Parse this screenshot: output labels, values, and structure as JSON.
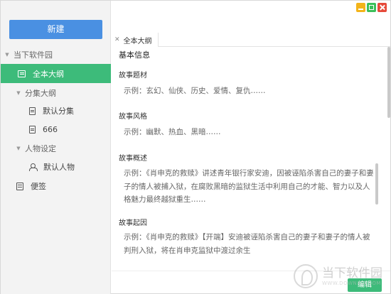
{
  "window": {
    "controls": [
      "minimize",
      "maximize",
      "close"
    ]
  },
  "sidebar": {
    "new_button": "新建",
    "groups": [
      {
        "label": "当下软件园"
      },
      {
        "label": "全本大纲"
      },
      {
        "label": "分集大纲"
      },
      {
        "label": "默认分集"
      },
      {
        "label": "666"
      },
      {
        "label": "人物设定"
      },
      {
        "label": "默认人物"
      },
      {
        "label": "便签"
      }
    ]
  },
  "tabs": [
    {
      "label": "全本大纲"
    }
  ],
  "content": {
    "section_main": "基本信息",
    "sections": [
      {
        "title": "故事题材",
        "text": "示例：玄幻、仙侠、历史、爱情、复仇……"
      },
      {
        "title": "故事风格",
        "text": "示例：幽默、热血、黑暗……"
      },
      {
        "title": "故事概述",
        "text": "示例：《肖申克的救赎》讲述青年银行家安迪，因被诬陷杀害自己的妻子和妻子的情人被捕入狱，在腐败黑暗的监狱生活中利用自己的才能、智力以及人格魅力最终越狱重生……"
      },
      {
        "title": "故事起因",
        "text": "示例：《肖申克的救赎》【开端】安迪被诬陷杀害自己的妻子和妻子的情人被判刑入狱，将在肖申克监狱中渡过余生"
      }
    ]
  },
  "footer": {
    "edit_button": "编辑"
  },
  "watermark": {
    "text": "当下软件园",
    "sub": "WWW.DOWNXIA.COM"
  },
  "colors": {
    "primary_blue": "#4a90e2",
    "accent_green": "#3dbb7a",
    "sidebar_bg": "#f3f3f3"
  }
}
